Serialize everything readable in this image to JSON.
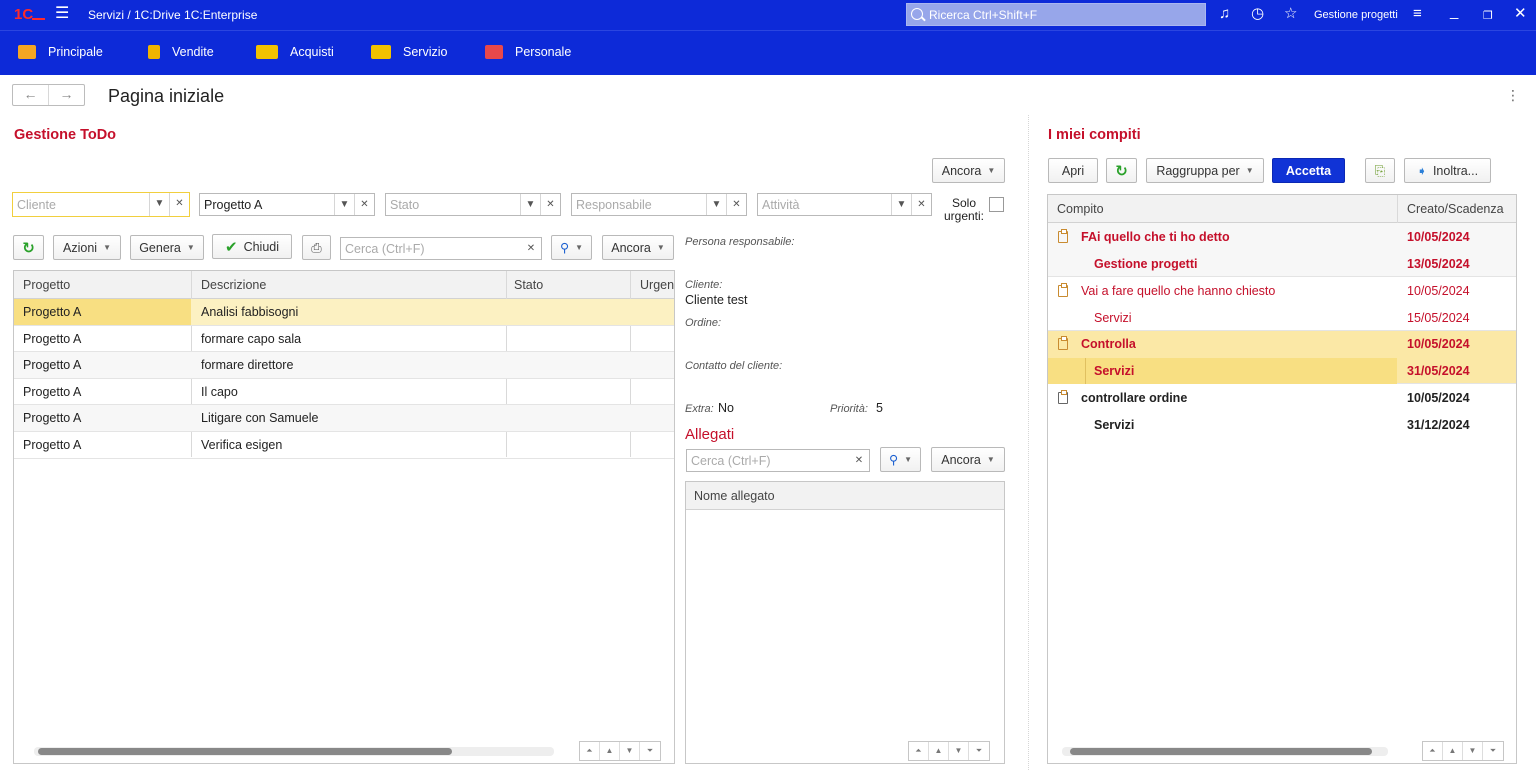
{
  "titlebar": {
    "breadcrumb": "Servizi / 1C:Drive 1C:Enterprise",
    "search_placeholder": "Ricerca Ctrl+Shift+F",
    "current_section": "Gestione progetti"
  },
  "menu": [
    {
      "label": "Principale",
      "color": "#f5a623"
    },
    {
      "label": "Vendite",
      "color": "#f0b400"
    },
    {
      "label": "Acquisti",
      "color": "#f2c200"
    },
    {
      "label": "Servizio",
      "color": "#f2c200"
    },
    {
      "label": "Personale",
      "color": "#e8484b"
    }
  ],
  "page": {
    "title": "Pagina iniziale"
  },
  "todo": {
    "title": "Gestione ToDo",
    "ancora_top": "Ancora",
    "filters": {
      "cliente_placeholder": "Cliente",
      "progetto_value": "Progetto A",
      "stato_placeholder": "Stato",
      "responsabile_placeholder": "Responsabile",
      "attivita_placeholder": "Attività",
      "solo_urgenti": "Solo urgenti:"
    },
    "toolbar": {
      "azioni": "Azioni",
      "genera": "Genera",
      "chiudi": "Chiudi",
      "search_placeholder": "Cerca (Ctrl+F)",
      "ancora": "Ancora"
    },
    "columns": [
      "Progetto",
      "Descrizione",
      "Stato",
      "Urgen"
    ],
    "rows": [
      {
        "progetto": "Progetto A",
        "descrizione": "Analisi fabbisogni"
      },
      {
        "progetto": "Progetto A",
        "descrizione": "formare capo sala"
      },
      {
        "progetto": "Progetto A",
        "descrizione": "formare direttore"
      },
      {
        "progetto": "Progetto A",
        "descrizione": "Il capo"
      },
      {
        "progetto": "Progetto A",
        "descrizione": "Litigare con Samuele"
      },
      {
        "progetto": "Progetto A",
        "descrizione": "Verifica esigen"
      }
    ]
  },
  "details": {
    "persona_label": "Persona responsabile:",
    "cliente_label": "Cliente:",
    "cliente_value": "Cliente test",
    "ordine_label": "Ordine:",
    "contatto_label": "Contatto del cliente:",
    "extra_label": "Extra:",
    "extra_value": "No",
    "priorita_label": "Priorità:",
    "priorita_value": "5"
  },
  "allegati": {
    "title": "Allegati",
    "search_placeholder": "Cerca (Ctrl+F)",
    "ancora": "Ancora",
    "column": "Nome allegato"
  },
  "compiti": {
    "title": "I miei compiti",
    "toolbar": {
      "apri": "Apri",
      "raggruppa": "Raggruppa per",
      "accetta": "Accetta",
      "inoltra": "Inoltra..."
    },
    "columns": [
      "Compito",
      "Creato/Scadenza"
    ],
    "rows": [
      {
        "task": "FAi quello che ti ho detto",
        "group": "Gestione progetti",
        "created": "10/05/2024",
        "due": "13/05/2024",
        "style": "red-bold"
      },
      {
        "task": "Vai a fare quello che hanno chiesto",
        "group": "Servizi",
        "created": "10/05/2024",
        "due": "15/05/2024",
        "style": "red"
      },
      {
        "task": "Controlla",
        "group": "Servizi",
        "created": "10/05/2024",
        "due": "31/05/2024",
        "style": "red-bold-selected"
      },
      {
        "task": "controllare ordine",
        "group": "Servizi",
        "created": "10/05/2024",
        "due": "31/12/2024",
        "style": "black-bold"
      }
    ]
  }
}
